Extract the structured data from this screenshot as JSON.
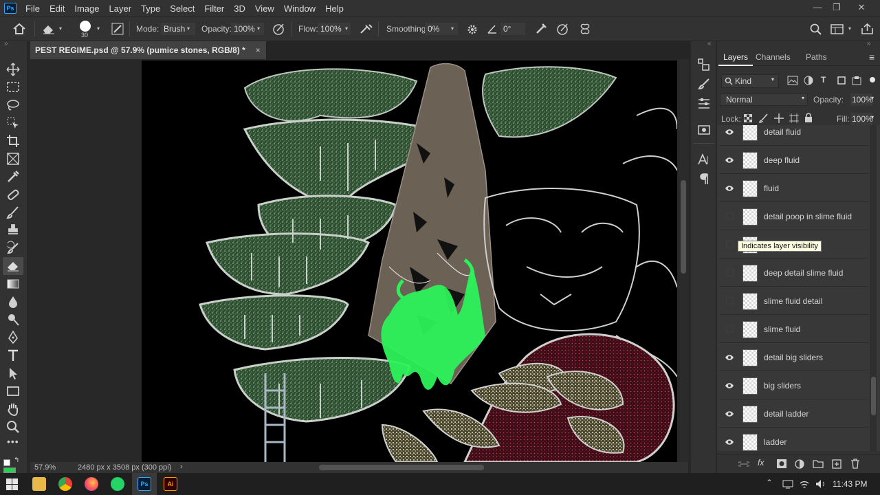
{
  "app": {
    "logo": "Ps",
    "brand_color": "#31a8ff"
  },
  "menu": [
    "File",
    "Edit",
    "Image",
    "Layer",
    "Type",
    "Select",
    "Filter",
    "3D",
    "View",
    "Window",
    "Help"
  ],
  "window_controls": {
    "minimize": "—",
    "restore": "❐",
    "close": "✕"
  },
  "options_bar": {
    "brush_size": "30",
    "mode_label": "Mode:",
    "mode_value": "Brush",
    "opacity_label": "Opacity:",
    "opacity_value": "100%",
    "flow_label": "Flow:",
    "flow_value": "100%",
    "smoothing_label": "Smoothing:",
    "smoothing_value": "0%",
    "angle_value": "0°"
  },
  "document": {
    "tab_title": "PEST REGIME.psd @ 57.9% (pumice stones, RGB/8) *",
    "close": "×"
  },
  "status": {
    "zoom": "57.9%",
    "doc_info": "2480 px x 3508 px (300 ppi)",
    "arrow": "›"
  },
  "panels": {
    "tabs": [
      "Layers",
      "Channels",
      "Paths"
    ],
    "filter_kind": "Kind",
    "blend_mode": "Normal",
    "opacity_label": "Opacity:",
    "opacity_value": "100%",
    "lock_label": "Lock:",
    "fill_label": "Fill:",
    "fill_value": "100%"
  },
  "layers": [
    {
      "name": "detail fluid",
      "visible": true
    },
    {
      "name": "deep fluid",
      "visible": true
    },
    {
      "name": "fluid",
      "visible": true
    },
    {
      "name": "detail poop in slime fluid",
      "visible": false
    },
    {
      "name": "",
      "visible": false
    },
    {
      "name": "deep detail slime fluid",
      "visible": false
    },
    {
      "name": "slime fluid detail",
      "visible": false
    },
    {
      "name": "slime fluid",
      "visible": false
    },
    {
      "name": "detail big sliders",
      "visible": true
    },
    {
      "name": "big sliders",
      "visible": true
    },
    {
      "name": "detail ladder",
      "visible": true
    },
    {
      "name": "ladder",
      "visible": true
    }
  ],
  "tooltip": "Indicates layer visibility",
  "taskbar": {
    "time": "11:43 PM"
  },
  "colors": {
    "slime_green": "#2cf25a",
    "moss_green": "#5e8c5a",
    "rock_brown": "#6b6155",
    "flesh_red": "#7a1c2c"
  }
}
